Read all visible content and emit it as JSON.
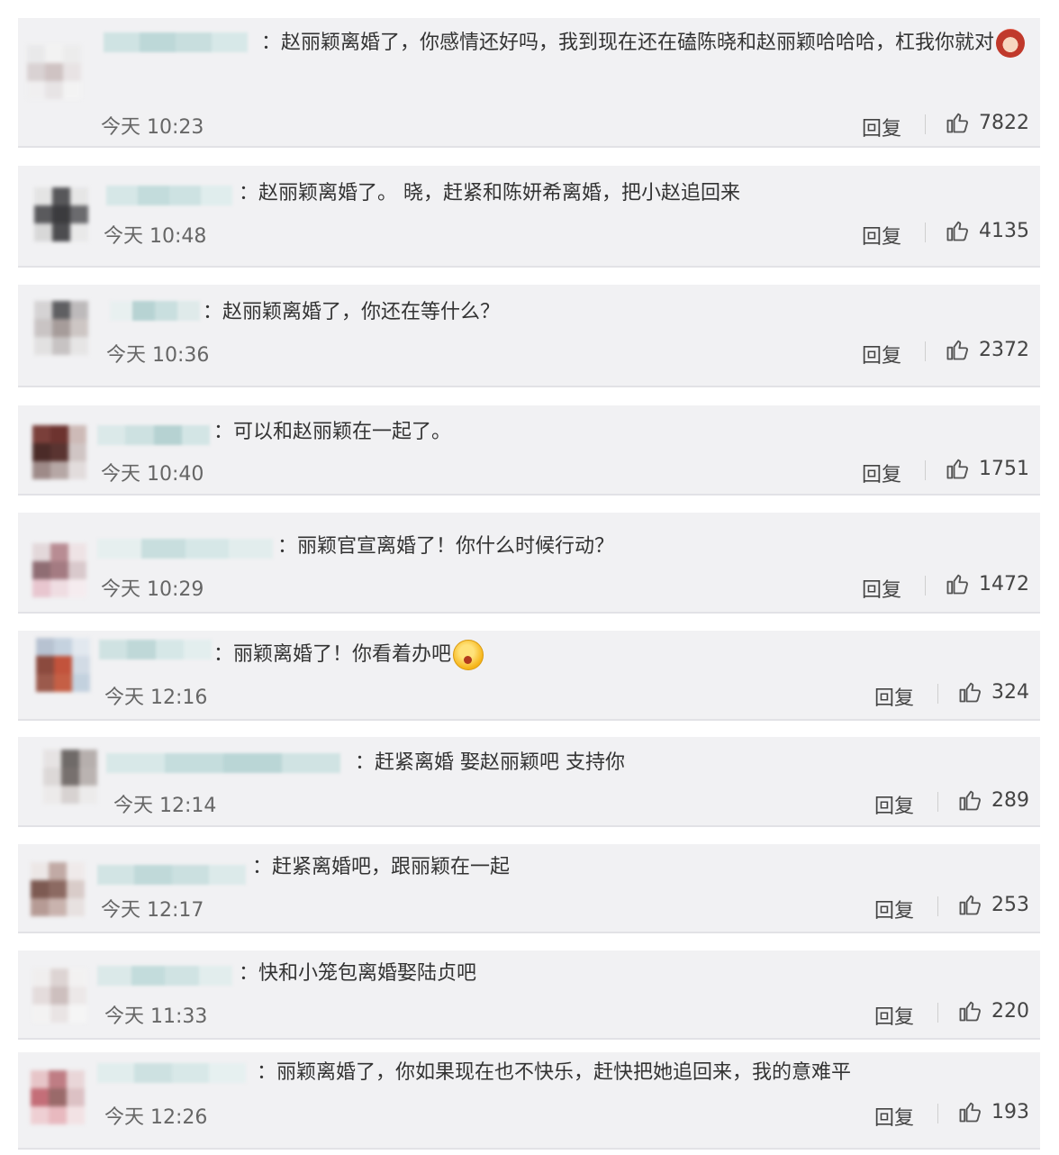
{
  "labels": {
    "reply": "回复"
  },
  "comments": [
    {
      "text": "：赵丽颖离婚了，你感情还好吗，我到现在还在磕陈晓和赵丽颖哈哈哈，杠我你就对",
      "emoji": "red",
      "time": "今天 10:23",
      "likes": "7822",
      "avatar": [
        "#e9e9ea",
        "#f2f2f2",
        "#ececec",
        "#d9d2d3",
        "#cfc3c3",
        "#e8e3e4",
        "#f0eff0",
        "#e7e4e5",
        "#f3f3f3"
      ],
      "user": [
        "#cfe3e3",
        "#bdd8d8",
        "#c8dede",
        "#d7e8e8"
      ]
    },
    {
      "text": "：赵丽颖离婚了。 晓，赶紧和陈妍希离婚，把小赵追回来",
      "time": "今天 10:48",
      "likes": "4135",
      "avatar": [
        "#e4e4e4",
        "#57575a",
        "#e6e6e6",
        "#5a5a5d",
        "#3b3b3e",
        "#6b6b6e",
        "#d8d8d8",
        "#4d4d50",
        "#e9e9e9"
      ],
      "user": [
        "#d6e7e7",
        "#c3dcdc",
        "#cde2e2",
        "#e0eded"
      ]
    },
    {
      "text": "：赵丽颖离婚了，你还在等什么？",
      "time": "今天 10:36",
      "likes": "2372",
      "avatar": [
        "#d5d3d4",
        "#5f5f62",
        "#bdbabb",
        "#c9c4c4",
        "#a69c9a",
        "#cdc6c4",
        "#e2e1e1",
        "#c7c3c3",
        "#e6e5e5"
      ],
      "user": [
        "#e8f0f0",
        "#b7d3d3",
        "#c9dfdf",
        "#dfeaea"
      ]
    },
    {
      "text": "：可以和赵丽颖在一起了。",
      "time": "今天 10:40",
      "likes": "1751",
      "avatar": [
        "#7a3f3a",
        "#6d332f",
        "#cdbab7",
        "#4b2b28",
        "#5a3431",
        "#d0c5c4",
        "#9e8a88",
        "#b6a7a5",
        "#e2dcdc"
      ],
      "user": [
        "#dbe9e9",
        "#cde1e1",
        "#b6d2d2",
        "#d3e5e5"
      ]
    },
    {
      "text": "：丽颖官宣离婚了！你什么时候行动？",
      "time": "今天 10:29",
      "likes": "1472",
      "avatar": [
        "#e3d8da",
        "#b88c93",
        "#eee3e5",
        "#8f6d73",
        "#a47b82",
        "#d9c9cc",
        "#e8c6cf",
        "#efdde2",
        "#f5ecef"
      ],
      "user": [
        "#e6efef",
        "#c8dede",
        "#d6e7e7",
        "#e2eded"
      ]
    },
    {
      "text": "：丽颖离婚了！你看着办吧",
      "emoji": "yellow",
      "time": "今天 12:16",
      "likes": "324",
      "avatar": [
        "#b7c2d1",
        "#c5d2df",
        "#e2e8ef",
        "#8b4a3e",
        "#c2533c",
        "#d2dbe5",
        "#9b5a4c",
        "#c55f45",
        "#c3d1de"
      ],
      "user": [
        "#cfe2e2",
        "#bfd8d8",
        "#d6e7e7",
        "#e3eeee"
      ]
    },
    {
      "text": "：赶紧离婚 娶赵丽颖吧 支持你",
      "time": "今天 12:14",
      "likes": "289",
      "avatar": [
        "#e6e3e3",
        "#6f6a68",
        "#b6afad",
        "#dcd8d7",
        "#77706e",
        "#bab3b1",
        "#eceaea",
        "#d7d2d1",
        "#ecebeb"
      ],
      "user": [
        "#d8e8e8",
        "#c5dddd",
        "#bad6d6",
        "#d0e3e3"
      ]
    },
    {
      "text": "：赶紧离婚吧，跟丽颖在一起",
      "time": "今天 12:17",
      "likes": "253",
      "avatar": [
        "#ece7e6",
        "#c1aaa5",
        "#efeaea",
        "#7d5a52",
        "#8c6a62",
        "#d9ccc9",
        "#b69b95",
        "#c9b3ae",
        "#e7e1e0"
      ],
      "user": [
        "#d2e4e4",
        "#c0d9d9",
        "#cbe0e0",
        "#dceaea"
      ]
    },
    {
      "text": "：快和小笼包离婚娶陆贞吧",
      "time": "今天 11:33",
      "likes": "220",
      "avatar": [
        "#f0eeee",
        "#ddd4d3",
        "#f2f1f1",
        "#e4dcdc",
        "#cdbfbe",
        "#ece8e8",
        "#f3f2f2",
        "#e9e4e4",
        "#f5f5f5"
      ],
      "user": [
        "#dbe9e9",
        "#c3dcdc",
        "#d0e3e3",
        "#e2eded"
      ]
    },
    {
      "text": "：丽颖离婚了，你如果现在也不快乐，赶快把她追回来，我的意难平",
      "time": "今天 12:26",
      "likes": "193",
      "avatar": [
        "#e7c5c8",
        "#bf7d84",
        "#e9d6d8",
        "#c46e78",
        "#9a6a6a",
        "#dcc1c4",
        "#eecfd3",
        "#e8b9bf",
        "#f2e2e4"
      ],
      "user": [
        "#e1eded",
        "#cde1e1",
        "#d8e8e8",
        "#e6f0f0"
      ]
    }
  ]
}
